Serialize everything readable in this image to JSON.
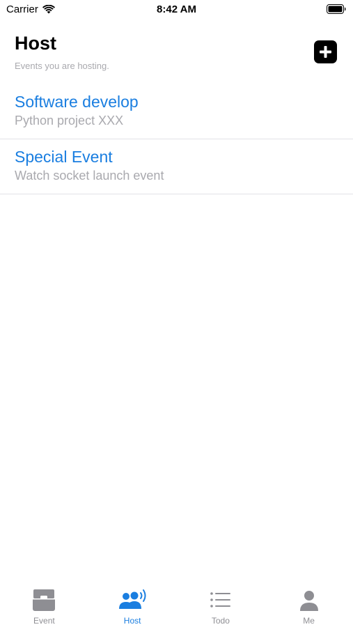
{
  "status_bar": {
    "carrier": "Carrier",
    "time": "8:42 AM"
  },
  "header": {
    "title": "Host",
    "subtitle": "Events you are hosting."
  },
  "events": [
    {
      "title": "Software develop",
      "subtitle": "Python project XXX"
    },
    {
      "title": "Special Event",
      "subtitle": "Watch socket launch event"
    }
  ],
  "tab_bar": {
    "tabs": [
      {
        "label": "Event",
        "icon": "tray-icon",
        "active": false
      },
      {
        "label": "Host",
        "icon": "people-broadcast-icon",
        "active": true
      },
      {
        "label": "Todo",
        "icon": "list-icon",
        "active": false
      },
      {
        "label": "Me",
        "icon": "person-icon",
        "active": false
      }
    ]
  },
  "colors": {
    "accent": "#1a7ee0",
    "inactive_tab": "#8e8e93",
    "subtitle_gray": "#a9a9ae",
    "separator": "#e2e2e6"
  }
}
